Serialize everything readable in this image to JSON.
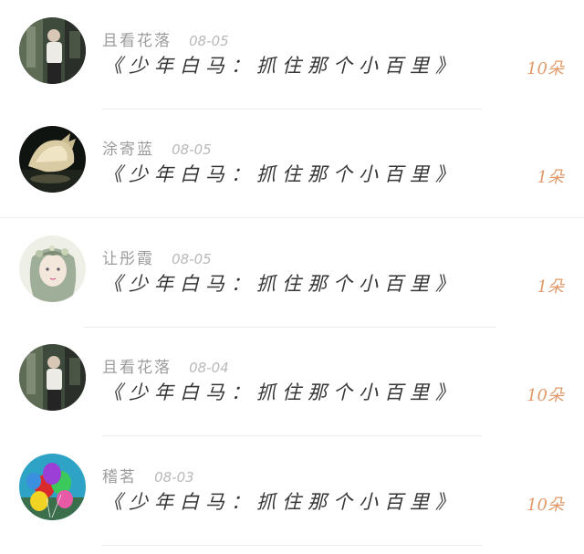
{
  "entries": [
    {
      "username": "且看花落",
      "date": "08-05",
      "title": "《少年白马：抓住那个小百里》",
      "count": "10朵",
      "avatar": "portrait-man-avatar"
    },
    {
      "username": "涂寄蓝",
      "date": "08-05",
      "title": "《少年白马：抓住那个小百里》",
      "count": "1朵",
      "avatar": "seashell-avatar"
    },
    {
      "username": "让彤霞",
      "date": "08-05",
      "title": "《少年白马：抓住那个小百里》",
      "count": "1朵",
      "avatar": "anime-girl-avatar"
    },
    {
      "username": "且看花落",
      "date": "08-04",
      "title": "《少年白马：抓住那个小百里》",
      "count": "10朵",
      "avatar": "portrait-man-avatar"
    },
    {
      "username": "稽茗",
      "date": "08-03",
      "title": "《少年白马：抓住那个小百里》",
      "count": "10朵",
      "avatar": "balloons-avatar"
    }
  ],
  "colors": {
    "username": "#9c9c9c",
    "date": "#b9b9b9",
    "title": "#353535",
    "count": "#e09a6a",
    "divider": "#ececec"
  }
}
